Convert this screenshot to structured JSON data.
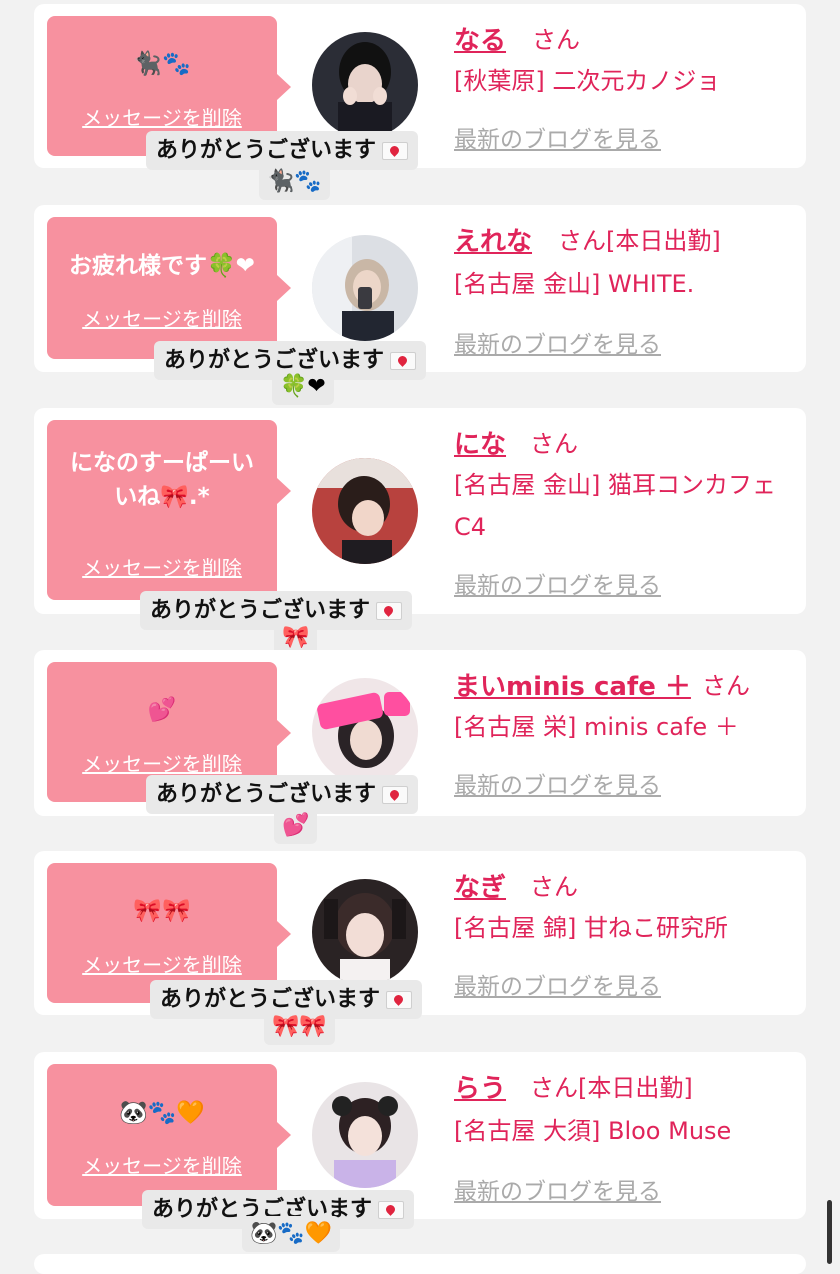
{
  "delete_label": "メッセージを削除",
  "thanks_label": "ありがとうございます",
  "blog_label": "最新のブログを見る",
  "san_label": "さん",
  "items": [
    {
      "name": "なる",
      "status": "",
      "shop": "[秋葉原] 二次元カノジョ",
      "message": "🐈‍⬛🐾",
      "reply_emoji": "🐈‍⬛🐾"
    },
    {
      "name": "えれな",
      "status": "[本日出勤]",
      "shop": "[名古屋 金山] WHITE.",
      "message": "お疲れ様です🍀❤",
      "reply_emoji": "🍀❤"
    },
    {
      "name": "にな",
      "status": "",
      "shop": "[名古屋 金山] 猫耳コンカフェ C4",
      "message": "になのすーぱーいいね🎀.*",
      "reply_emoji": "🎀"
    },
    {
      "name": "まいminis cafe ＋",
      "status": "",
      "shop": "[名古屋 栄] minis cafe ＋",
      "message": "💕",
      "reply_emoji": "💕"
    },
    {
      "name": "なぎ",
      "status": "",
      "shop": "[名古屋 錦] 甘ねこ研究所",
      "message": "🎀🎀",
      "reply_emoji": "🎀🎀"
    },
    {
      "name": "らう",
      "status": "[本日出勤]",
      "shop": "[名古屋 大須] Bloo Muse",
      "message": "🐼🐾🧡",
      "reply_emoji": "🐼🐾🧡"
    }
  ]
}
